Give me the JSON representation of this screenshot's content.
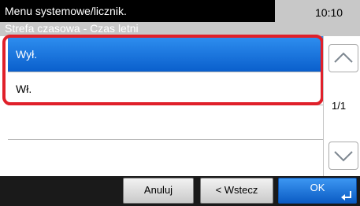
{
  "header": {
    "title": "Menu systemowe/licznik.",
    "subtitle": "Strefa czasowa - Czas letni",
    "time": "10:10"
  },
  "options": [
    {
      "label": "Wył.",
      "selected": true
    },
    {
      "label": "Wł.",
      "selected": false
    },
    {
      "label": "",
      "selected": false
    },
    {
      "label": "",
      "selected": false
    }
  ],
  "pager": {
    "page": "1/1"
  },
  "footer": {
    "cancel_label": "Anuluj",
    "back_label": "< Wstecz",
    "ok_label": "OK"
  },
  "colors": {
    "selected_row": "#1a73e0",
    "highlight_border": "#e0202a",
    "title_bar": "#000000",
    "footer_bar": "#1a1a1a"
  },
  "icons": {
    "scroll_up": "chevron-up-icon",
    "scroll_down": "chevron-down-icon",
    "ok": "enter-arrow-icon"
  }
}
